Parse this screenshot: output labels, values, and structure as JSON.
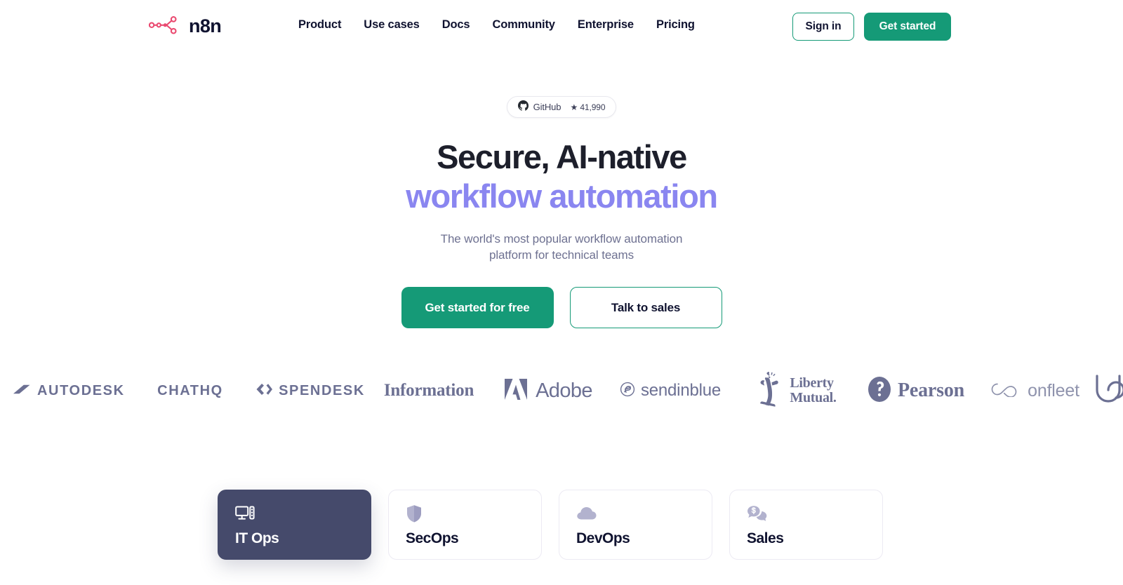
{
  "header": {
    "brand": {
      "word": "n8n",
      "mark_icon": "n8n-logo-icon",
      "accent": "#ea4b71"
    },
    "nav": [
      {
        "label": "Product"
      },
      {
        "label": "Use cases"
      },
      {
        "label": "Docs"
      },
      {
        "label": "Community"
      },
      {
        "label": "Enterprise"
      },
      {
        "label": "Pricing"
      }
    ],
    "sign_in_label": "Sign in",
    "get_started_label": "Get started"
  },
  "hero": {
    "github_badge": {
      "icon": "github-icon",
      "label": "GitHub",
      "stars": "★ 41,990"
    },
    "headline_line1": "Secure, AI-native",
    "headline_line2": "workflow automation",
    "subhead": "The world's most popular workflow automation platform for technical teams",
    "cta_primary_label": "Get started for free",
    "cta_secondary_label": "Talk to sales"
  },
  "logos": [
    {
      "name": "Autodesk",
      "text": "AUTODESK",
      "icon": "autodesk-arrow-icon"
    },
    {
      "name": "ChatHQ",
      "text": "CHATHQ",
      "icon": null
    },
    {
      "name": "Spendesk",
      "text": "SPENDESK",
      "icon": "spendesk-chevron-icon"
    },
    {
      "name": "Information",
      "text": "Information",
      "icon": null
    },
    {
      "name": "Adobe",
      "text": "Adobe",
      "icon": "adobe-a-icon"
    },
    {
      "name": "Sendinblue",
      "text": "sendinblue",
      "icon": "sendinblue-swirl-icon"
    },
    {
      "name": "Liberty Mutual",
      "text": "Liberty\nMutual.",
      "icon": "statue-of-liberty-icon"
    },
    {
      "name": "Pearson",
      "text": "Pearson",
      "icon": "pearson-p-icon"
    },
    {
      "name": "Onfleet",
      "text": "onfleet",
      "icon": "onfleet-infinity-icon"
    },
    {
      "name": "Unbabel",
      "text": "",
      "icon": "u-mark-icon"
    }
  ],
  "usecases": [
    {
      "label": "IT Ops",
      "icon": "monitor-icon",
      "active": true
    },
    {
      "label": "SecOps",
      "icon": "shield-icon",
      "active": false
    },
    {
      "label": "DevOps",
      "icon": "cloud-icon",
      "active": false
    },
    {
      "label": "Sales",
      "icon": "chat-dollar-icon",
      "active": false
    }
  ],
  "colors": {
    "brand_pink": "#ea4b71",
    "teal": "#159a77",
    "purple": "#8a86f0",
    "navy": "#101330",
    "card_active": "#454a6b",
    "muted": "#6e7191",
    "logo_gray": "#6c7093"
  }
}
